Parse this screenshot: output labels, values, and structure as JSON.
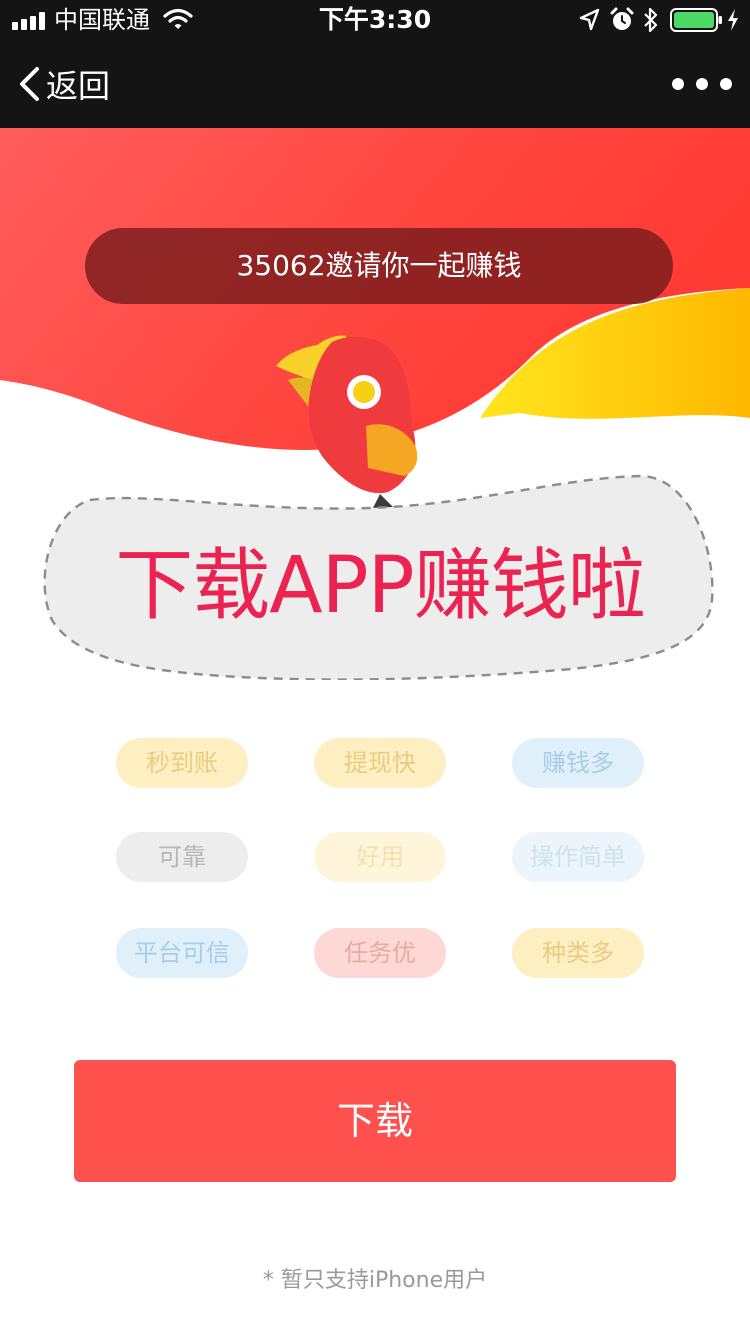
{
  "status_bar": {
    "carrier": "中国联通",
    "time": "下午3:30",
    "icons": [
      "signal-icon",
      "wifi-icon",
      "location-icon",
      "alarm-icon",
      "bluetooth-icon",
      "battery-icon",
      "charging-icon"
    ],
    "battery_level": 1.0
  },
  "nav_bar": {
    "back_label": "返回",
    "icons": [
      "chevron-left-icon",
      "more-icon"
    ]
  },
  "hero": {
    "invite_text": "35062邀请你一起赚钱",
    "headline": "下载APP赚钱啦"
  },
  "tags": [
    {
      "label": "秒到账",
      "color": "#e8cc82"
    },
    {
      "label": "提现快",
      "color": "#e8cc82"
    },
    {
      "label": "赚钱多",
      "color": "#a9cde6"
    },
    {
      "label": "可靠",
      "color": "#b6b6b6"
    },
    {
      "label": "好用",
      "color": "#f3e1ae"
    },
    {
      "label": "操作简单",
      "color": "#cde2ef"
    },
    {
      "label": "平台可信",
      "color": "#a9cde6"
    },
    {
      "label": "任务优",
      "color": "#e8aaa4"
    },
    {
      "label": "种类多",
      "color": "#e8cc82"
    }
  ],
  "download": {
    "label": "下载"
  },
  "footnote": "* 暂只支持iPhone用户",
  "colors": {
    "accent_red": "#fe504c",
    "headline_pink": "#ea2350",
    "nav_background": "#141414",
    "hero_yellow": "#ffc400"
  }
}
